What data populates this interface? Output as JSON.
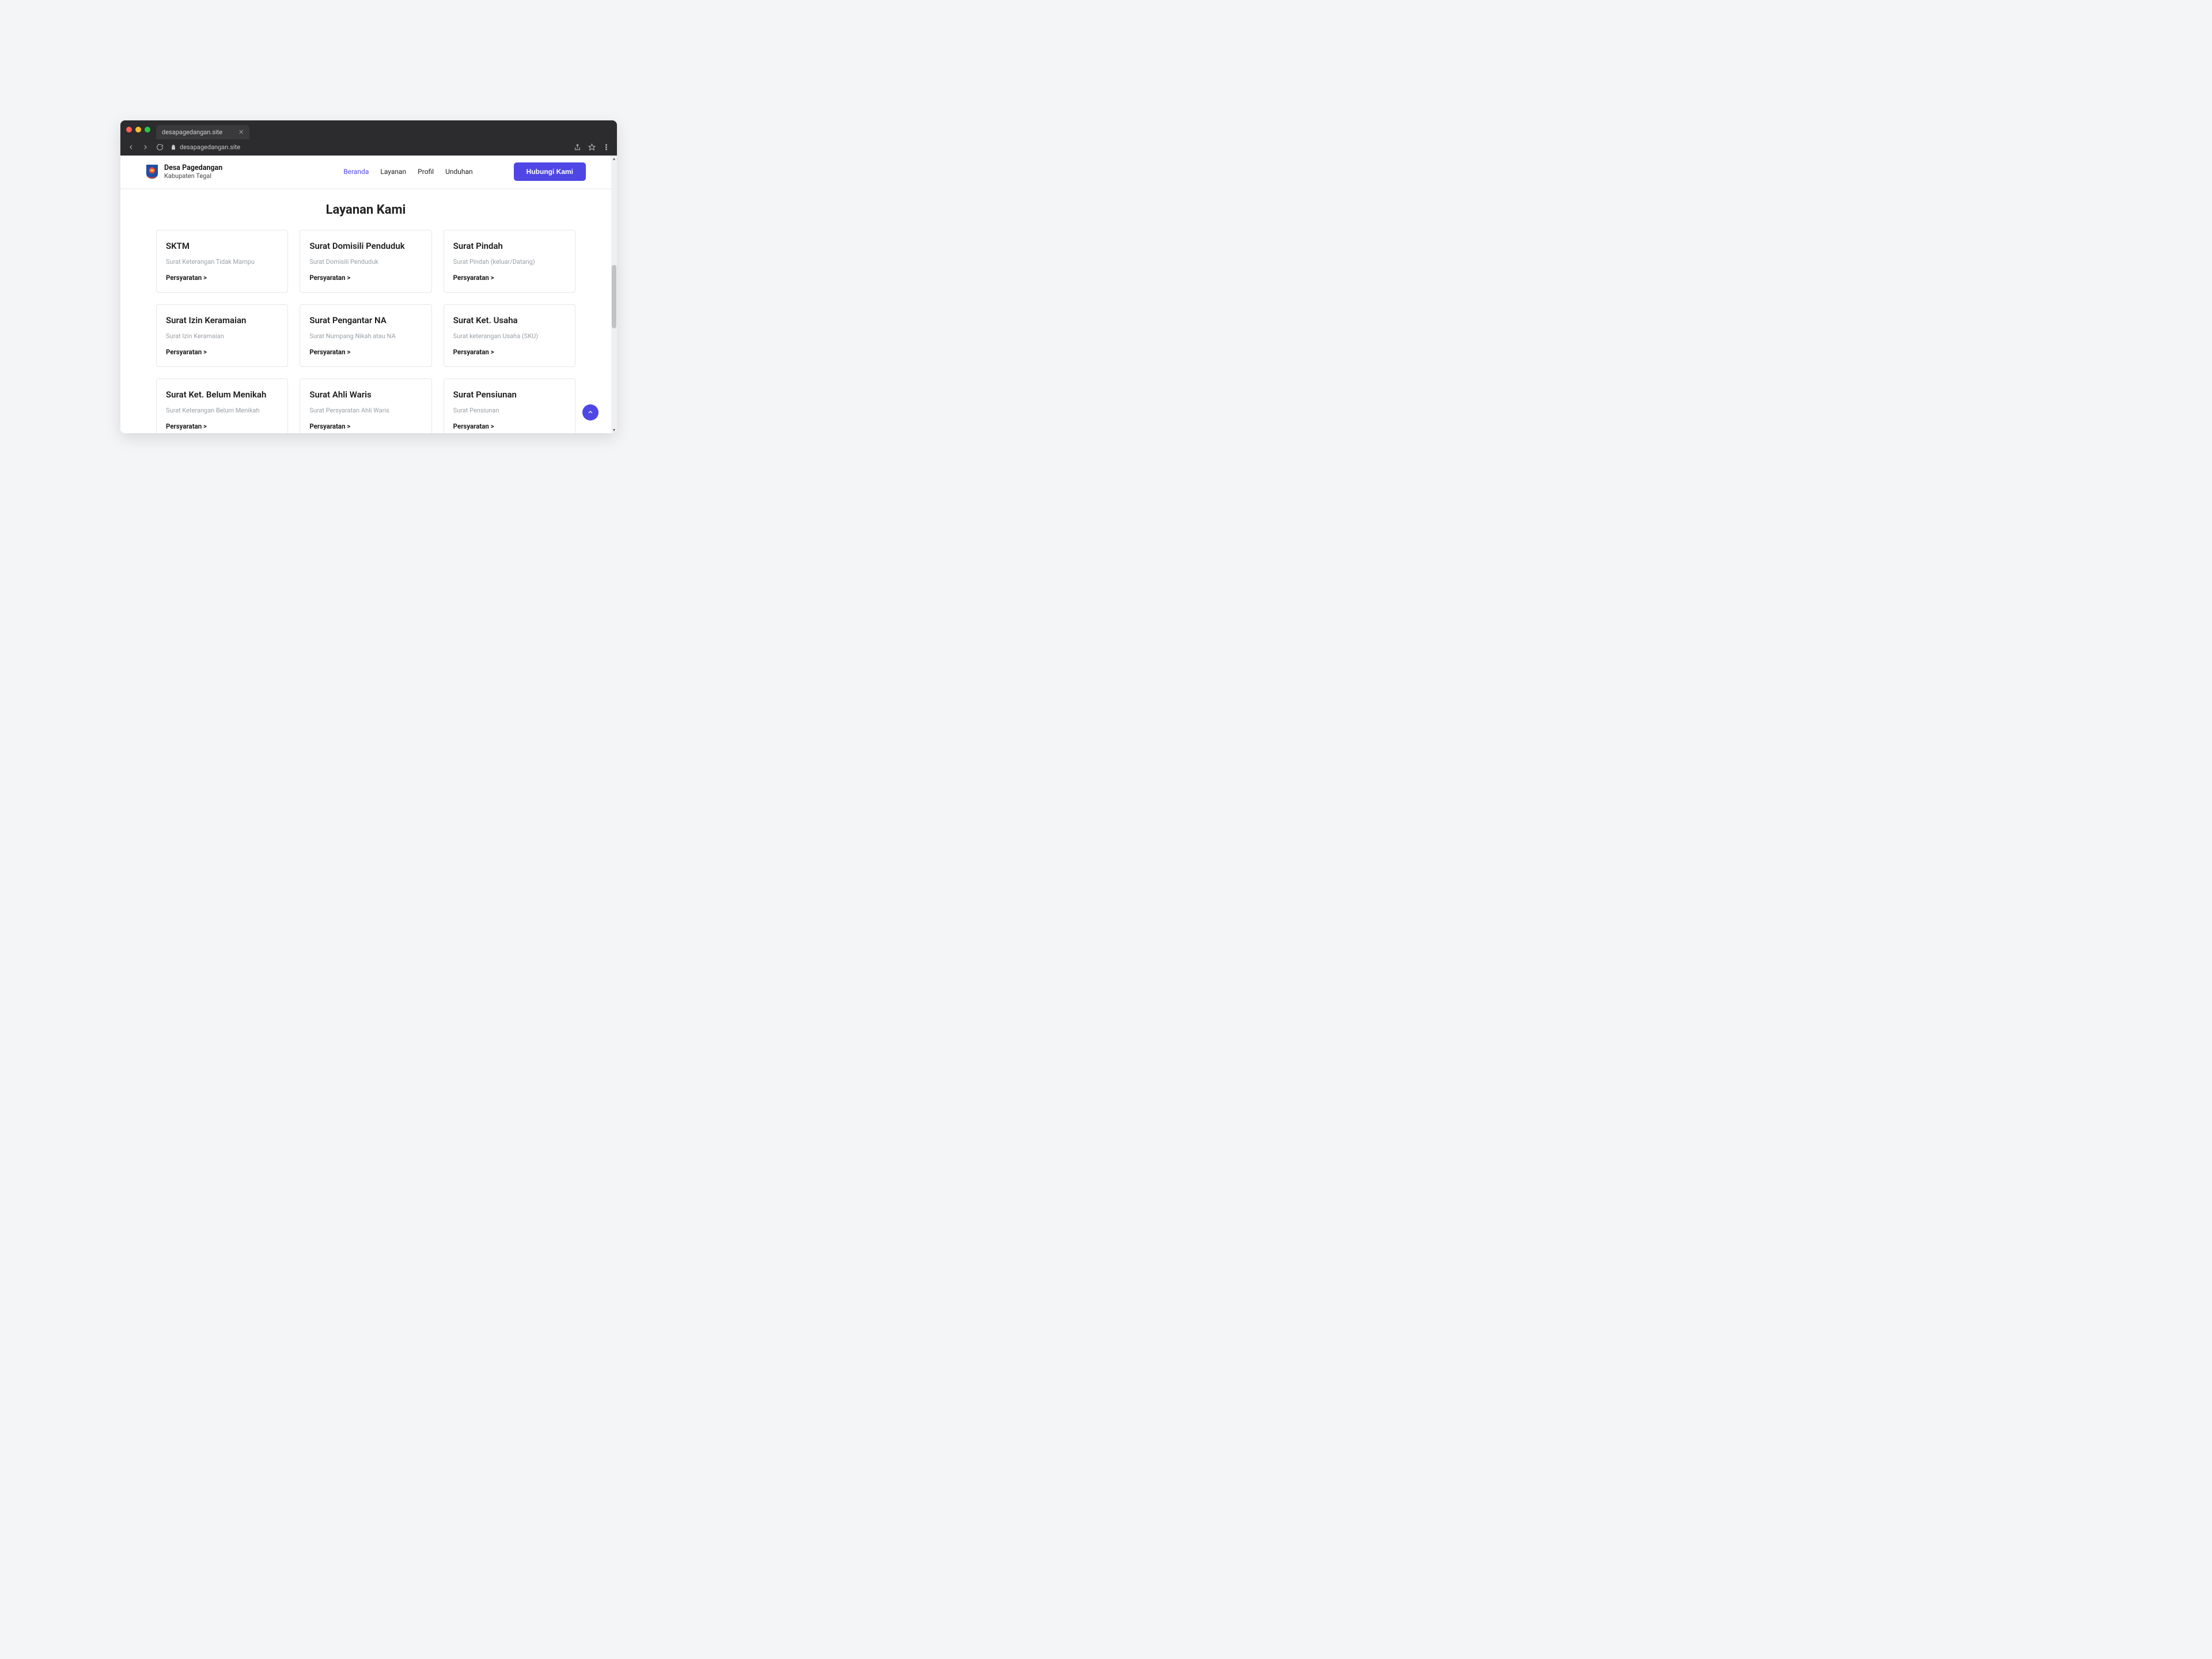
{
  "browser": {
    "tab_title": "desapagedangan.site",
    "url": "desapagedangan.site"
  },
  "header": {
    "brand_name": "Desa Pagedangan",
    "brand_sub": "Kabupaten Tegal",
    "nav": [
      "Beranda",
      "Layanan",
      "Profil",
      "Unduhan"
    ],
    "active_nav_index": 0,
    "contact_label": "Hubungi Kami"
  },
  "section_title": "Layanan Kami",
  "link_label": "Persyaratan >",
  "cards": [
    {
      "title": "SKTM",
      "desc": "Surat Keterangan Tidak Mampu"
    },
    {
      "title": "Surat Domisili Penduduk",
      "desc": "Surat Domisili Penduduk"
    },
    {
      "title": "Surat Pindah",
      "desc": "Surat Pindah (keluar/Datang)"
    },
    {
      "title": "Surat Izin Keramaian",
      "desc": "Surat Izin Keramaian"
    },
    {
      "title": "Surat Pengantar NA",
      "desc": "Surat Numpang Nikah atau NA"
    },
    {
      "title": "Surat Ket. Usaha",
      "desc": "Surat keterangan Usaha (SKU)"
    },
    {
      "title": "Surat Ket. Belum Menikah",
      "desc": "Surat Keterangan Belum Menikah"
    },
    {
      "title": "Surat Ahli Waris",
      "desc": "Surat Persyaratan Ahli Waris"
    },
    {
      "title": "Surat Pensiunan",
      "desc": "Surat Pensiunan"
    }
  ]
}
